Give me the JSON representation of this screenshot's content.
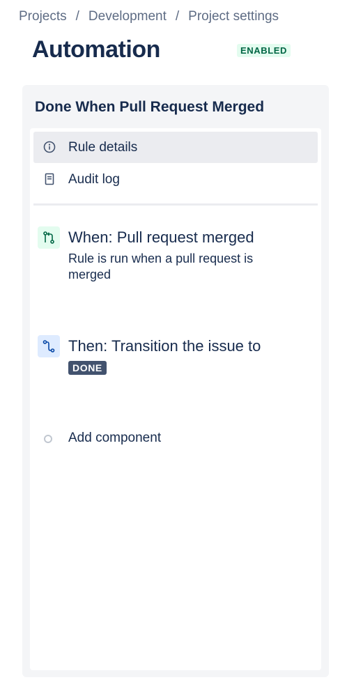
{
  "breadcrumb": {
    "items": [
      "Projects",
      "Development",
      "Project settings"
    ],
    "separator": "/"
  },
  "header": {
    "title": "Automation",
    "status": "ENABLED"
  },
  "rule": {
    "name": "Done When Pull Request Merged",
    "nav": [
      {
        "label": "Rule details",
        "icon": "info-icon",
        "active": true
      },
      {
        "label": "Audit log",
        "icon": "document-icon",
        "active": false
      }
    ],
    "trigger": {
      "icon": "pull-request-icon",
      "title": "When: Pull request merged",
      "description": "Rule is run when a pull request is merged",
      "color": "#e3fcef"
    },
    "action": {
      "icon": "transition-icon",
      "title": "Then: Transition the issue to",
      "status_lozenge": "DONE",
      "color": "#deebff"
    },
    "add_component_label": "Add component"
  },
  "colors": {
    "badge_bg": "#e3fcef",
    "badge_text": "#006644",
    "lozenge_bg": "#42526e",
    "panel_bg": "#f4f5f7"
  }
}
